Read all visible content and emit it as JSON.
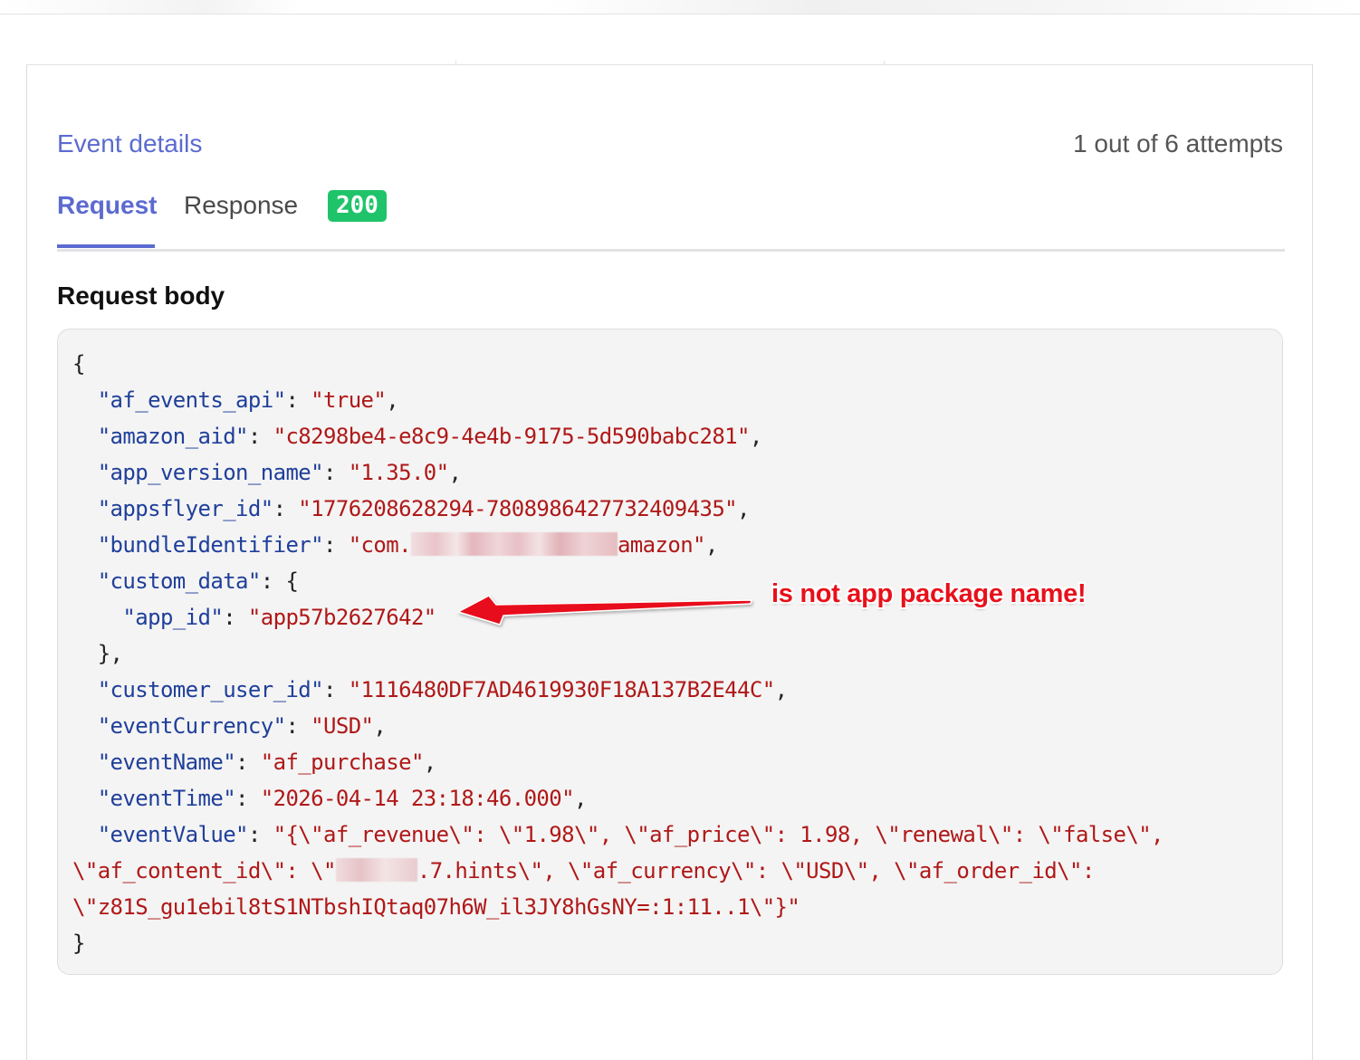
{
  "header": {
    "title": "Event details",
    "attempts": "1 out of 6 attempts"
  },
  "tabs": [
    {
      "label": "Request",
      "active": true
    },
    {
      "label": "Response",
      "active": false
    }
  ],
  "status_code": "200",
  "colors": {
    "accent": "#5b6bd0",
    "status_success": "#1fc46a",
    "json_key": "#1f3f9a",
    "json_string": "#b01818",
    "annotation": "#e8101a"
  },
  "request_body": {
    "title": "Request body",
    "lines": {
      "open_brace": "{",
      "af_events_api_key": "\"af_events_api\"",
      "af_events_api_val": "\"true\"",
      "amazon_aid_key": "\"amazon_aid\"",
      "amazon_aid_val": "\"c8298be4-e8c9-4e4b-9175-5d590babc281\"",
      "app_version_name_key": "\"app_version_name\"",
      "app_version_name_val": "\"1.35.0\"",
      "appsflyer_id_key": "\"appsflyer_id\"",
      "appsflyer_id_val": "\"1776208628294-7808986427732409435\"",
      "bundle_identifier_key": "\"bundleIdentifier\"",
      "bundle_identifier_val_start": "\"com.",
      "bundle_identifier_val_end": "amazon\"",
      "custom_data_key": "\"custom_data\"",
      "app_id_key": "\"app_id\"",
      "app_id_val": "\"app57b2627642\"",
      "custom_data_close": "},",
      "customer_user_id_key": "\"customer_user_id\"",
      "customer_user_id_val": "\"1116480DF7AD4619930F18A137B2E44C\"",
      "event_currency_key": "\"eventCurrency\"",
      "event_currency_val": "\"USD\"",
      "event_name_key": "\"eventName\"",
      "event_name_val": "\"af_purchase\"",
      "event_time_key": "\"eventTime\"",
      "event_time_val": "\"2026-04-14 23:18:46.000\"",
      "event_value_key": "\"eventValue\"",
      "event_value_line1": "\"{\\\"af_revenue\\\": \\\"1.98\\\", \\\"af_price\\\": 1.98, \\\"renewal\\\": \\\"false\\\",",
      "event_value_line2_start": "\\\"af_content_id\\\": \\\"",
      "event_value_line2_end": ".7.hints\\\", \\\"af_currency\\\": \\\"USD\\\", \\\"af_order_id\\\":",
      "event_value_line3": "\\\"z81S_gu1ebil8tS1NTbshIQtaq07h6W_il3JY8hGsNY=:1:11..1\\\"}\"",
      "close_brace": "}"
    }
  },
  "annotation": {
    "text": "is not app package name!"
  }
}
